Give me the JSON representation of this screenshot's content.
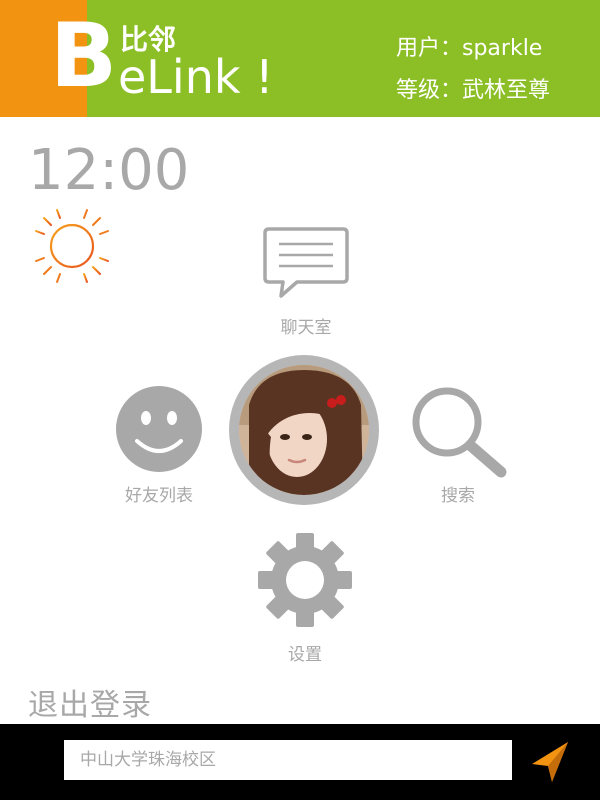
{
  "header": {
    "logo_letter": "B",
    "logo_cn": "比邻",
    "logo_text": "eLink !",
    "user_label": "用户：sparkle",
    "level_label": "等级：武林至尊",
    "colors": {
      "green": "#8cbf26",
      "orange": "#f29411"
    }
  },
  "clock": {
    "time": "12:00"
  },
  "weather": {
    "icon": "sun-icon"
  },
  "menu": {
    "chat": {
      "label": "聊天室",
      "icon": "chat-bubble-icon"
    },
    "friends": {
      "label": "好友列表",
      "icon": "smiley-icon"
    },
    "search": {
      "label": "搜索",
      "icon": "magnifier-icon"
    },
    "settings": {
      "label": "设置",
      "icon": "gear-icon"
    },
    "avatar": {
      "icon": "user-avatar"
    }
  },
  "logout": {
    "label": "退出登录"
  },
  "bottom_bar": {
    "location_placeholder": "中山大学珠海校区",
    "nav_icon": "navigation-arrow-icon"
  }
}
